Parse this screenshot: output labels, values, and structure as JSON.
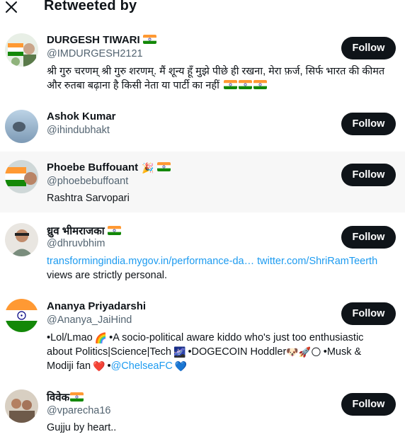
{
  "header": {
    "title": "Retweeted by",
    "close_icon": "close-icon"
  },
  "follow_label": "Follow",
  "users": [
    {
      "name": "DURGESH TIWARI",
      "handle": "@IMDURGESH2121",
      "bio_line1": "श्री गुरु चरणम् श्री गुरु शरणम्. मैं शून्य हूँ मुझे पीछे ही रखना, मेरा फ़र्ज, सिर्फ भारत की कीमत",
      "bio_line2": "और रुतबा बढ़ाना है किसी नेता या पार्टी का नहीं"
    },
    {
      "name": "Ashok Kumar",
      "handle": "@ihindubhakt"
    },
    {
      "name": "Phoebe Buffouant",
      "handle": "@phoebebuffoant",
      "bio": "Rashtra Sarvopari"
    },
    {
      "name": "ध्रुव भीमराजका",
      "handle": "@dhruvbhim",
      "link1": "transformingindia.mygov.in/performance-da…",
      "link2": "twitter.com/ShriRamTeerth",
      "bio_line2": "views are strictly personal."
    },
    {
      "name": "Ananya Priyadarshi",
      "handle": "@Ananya_JaiHind",
      "bio_part1": "•Lol/Lmao",
      "bio_part2": "•A socio-political aware kiddo who's just too enthusiastic",
      "bio_part3": "about Politics|Science|Tech",
      "bio_part4": "•DOGECOIN Hoddler",
      "bio_part5": "•Musk &",
      "bio_part6": "Modiji fan",
      "bio_part7": "•",
      "bio_link": "@ChelseaFC"
    },
    {
      "name": "विवेक",
      "handle": "@vparecha16",
      "bio": "Gujju by heart.."
    }
  ],
  "colors": {
    "follow_bg": "#0f1419",
    "link": "#1d9bf0",
    "handle": "#536471",
    "highlight_row": "#f7f7f7"
  }
}
